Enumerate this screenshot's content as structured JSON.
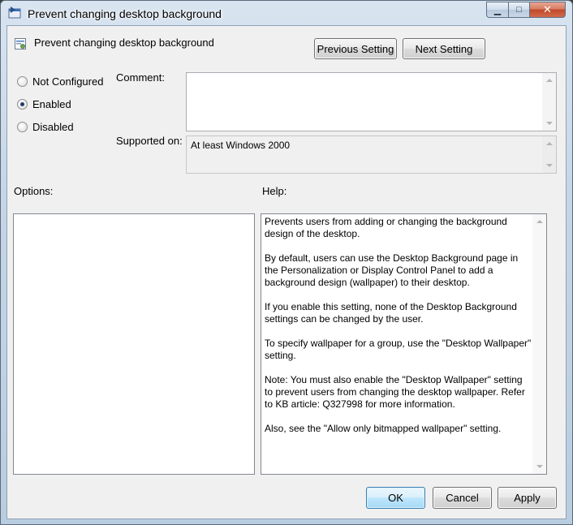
{
  "window": {
    "title": "Prevent changing desktop background",
    "min_glyph": "▁",
    "max_glyph": "□",
    "close_glyph": "✕"
  },
  "header": {
    "policy_name": "Prevent changing desktop background",
    "previous_label": "Previous Setting",
    "next_label": "Next Setting"
  },
  "state": {
    "options": [
      {
        "label": "Not Configured",
        "checked": false
      },
      {
        "label": "Enabled",
        "checked": true
      },
      {
        "label": "Disabled",
        "checked": false
      }
    ]
  },
  "comment": {
    "label": "Comment:",
    "value": ""
  },
  "supported": {
    "label": "Supported on:",
    "value": "At least Windows 2000"
  },
  "sections": {
    "options_label": "Options:",
    "help_label": "Help:"
  },
  "help": {
    "paragraphs": [
      "Prevents users from adding or changing the background design of the desktop.",
      "By default, users can use the Desktop Background page in the Personalization or Display Control Panel to add a background design (wallpaper) to their desktop.",
      "If you enable this setting, none of the Desktop Background settings can be changed by the user.",
      "To specify wallpaper for a group, use the \"Desktop Wallpaper\" setting.",
      "Note: You must also enable the \"Desktop Wallpaper\" setting to prevent users from changing the desktop wallpaper. Refer to KB article: Q327998 for more information.",
      "Also, see the \"Allow only bitmapped wallpaper\" setting."
    ]
  },
  "footer": {
    "ok_label": "OK",
    "cancel_label": "Cancel",
    "apply_label": "Apply"
  }
}
